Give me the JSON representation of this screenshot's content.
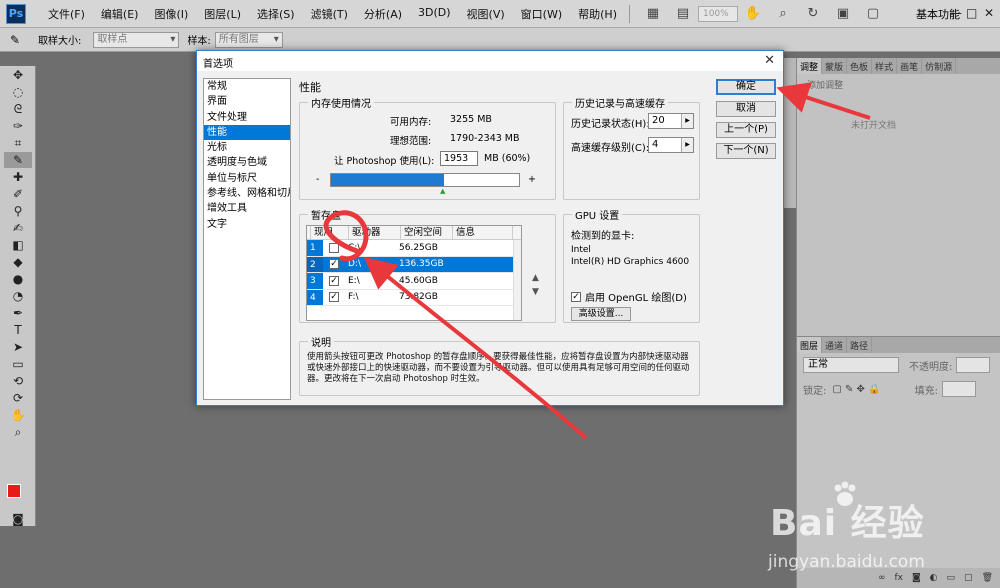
{
  "app": {
    "logo": "Ps",
    "menu": [
      "文件(F)",
      "编辑(E)",
      "图像(I)",
      "图层(L)",
      "选择(S)",
      "滤镜(T)",
      "分析(A)",
      "3D(D)",
      "视图(V)",
      "窗口(W)",
      "帮助(H)"
    ],
    "zoom": "100%",
    "workspace": "基本功能",
    "window_min": "—",
    "window_max": "□",
    "window_close": "✕"
  },
  "options_bar": {
    "sample_size_label": "取样大小:",
    "sample_size_value": "取样点",
    "sample_label": "样本:",
    "sample_value": "所有图层"
  },
  "right_panel": {
    "tabs": [
      "调整",
      "蒙版",
      "色板",
      "样式",
      "画笔",
      "仿制源"
    ],
    "adjust_hint": "添加调整",
    "no_document": "未打开文档",
    "layer_tabs": [
      "图层",
      "通道",
      "路径"
    ],
    "blend_mode": "正常",
    "opacity_label": "不透明度:",
    "lock_label": "锁定:",
    "fill_label": "填充:"
  },
  "dialog": {
    "title": "首选项",
    "categories": [
      "常规",
      "界面",
      "文件处理",
      "性能",
      "光标",
      "透明度与色域",
      "单位与标尺",
      "参考线、网格和切片",
      "增效工具",
      "文字"
    ],
    "selected_category": "性能",
    "section_title": "性能",
    "memory": {
      "legend": "内存使用情况",
      "available_label": "可用内存:",
      "available_value": "3255 MB",
      "ideal_label": "理想范围:",
      "ideal_value": "1790-2343 MB",
      "use_label": "让 Photoshop 使用(L):",
      "use_value": "1953",
      "use_suffix": "MB (60%)",
      "percent": 60,
      "minus": "-",
      "plus": "+"
    },
    "history": {
      "legend": "历史记录与高速缓存",
      "states_label": "历史记录状态(H):",
      "states_value": "20",
      "cache_label": "高速缓存级别(C):",
      "cache_value": "4"
    },
    "scratch": {
      "legend": "暂存盘",
      "columns": [
        "现用",
        "驱动器",
        "空闲空间",
        "信息"
      ],
      "rows": [
        {
          "num": "1",
          "checked": false,
          "drive": "C:\\",
          "space": "56.25GB",
          "info": ""
        },
        {
          "num": "2",
          "checked": true,
          "drive": "D:\\",
          "space": "136.35GB",
          "info": ""
        },
        {
          "num": "3",
          "checked": true,
          "drive": "E:\\",
          "space": "45.60GB",
          "info": ""
        },
        {
          "num": "4",
          "checked": true,
          "drive": "F:\\",
          "space": "73.82GB",
          "info": ""
        }
      ],
      "selected_row": 1
    },
    "gpu": {
      "legend": "GPU 设置",
      "detected_label": "检测到的显卡:",
      "vendor": "Intel",
      "model": "Intel(R) HD Graphics 4600",
      "opengl_label": "启用 OpenGL 绘图(D)",
      "opengl_checked": true,
      "advanced_label": "高级设置..."
    },
    "description": {
      "legend": "说明",
      "text": "使用箭头按钮可更改 Photoshop 的暂存盘顺序。要获得最佳性能，应将暂存盘设置为内部快速驱动器或快速外部接口上的快速驱动器，而不要设置为引导驱动器。但可以使用具有足够可用空间的任何驱动器。更改将在下一次启动 Photoshop 时生效。"
    },
    "buttons": {
      "ok": "确定",
      "cancel": "取消",
      "prev": "上一个(P)",
      "next": "下一个(N)"
    }
  },
  "colors": {
    "accent": "#0078d7",
    "annotation": "#e8383b",
    "foreground": "#e61b1b"
  },
  "watermark": {
    "logo": "Bai 经验",
    "url": "jingyan.baidu.com"
  }
}
